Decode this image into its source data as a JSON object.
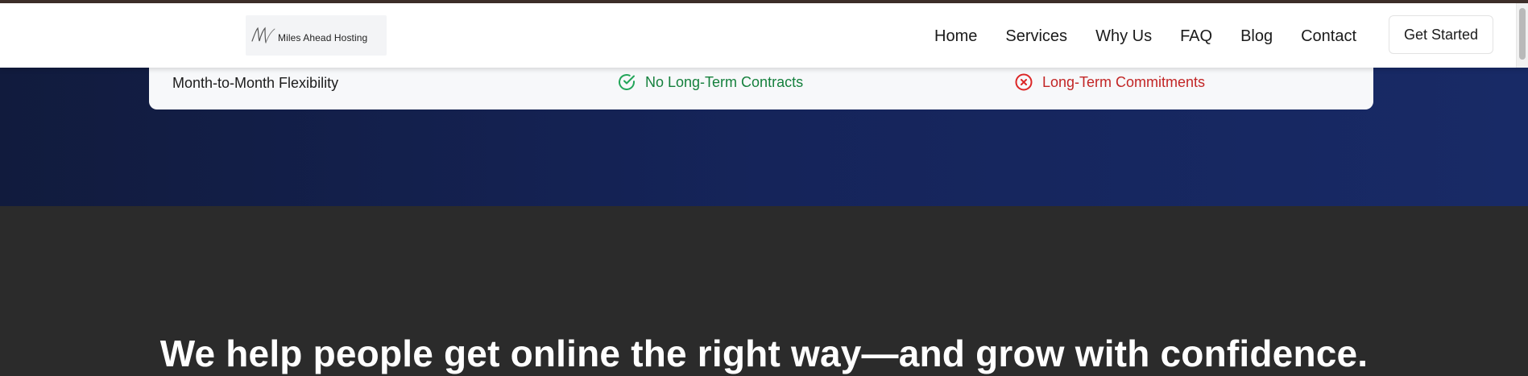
{
  "brand": {
    "logo_text": "Miles Ahead Hosting"
  },
  "nav": {
    "links": [
      "Home",
      "Services",
      "Why Us",
      "FAQ",
      "Blog",
      "Contact"
    ],
    "cta_label": "Get Started"
  },
  "comparison": {
    "row_label": "Month-to-Month Flexibility",
    "yes_text": "No Long-Term Contracts",
    "no_text": "Long-Term Commitments"
  },
  "tagline": "We help people get online the right way—and grow with confidence.",
  "colors": {
    "brand_dark_blue": "#15245a",
    "success_green": "#15803d",
    "danger_red": "#c22525",
    "section_dark": "#2b2b2b"
  },
  "icons": {
    "yes": "check-circle-icon",
    "no": "x-circle-icon"
  }
}
